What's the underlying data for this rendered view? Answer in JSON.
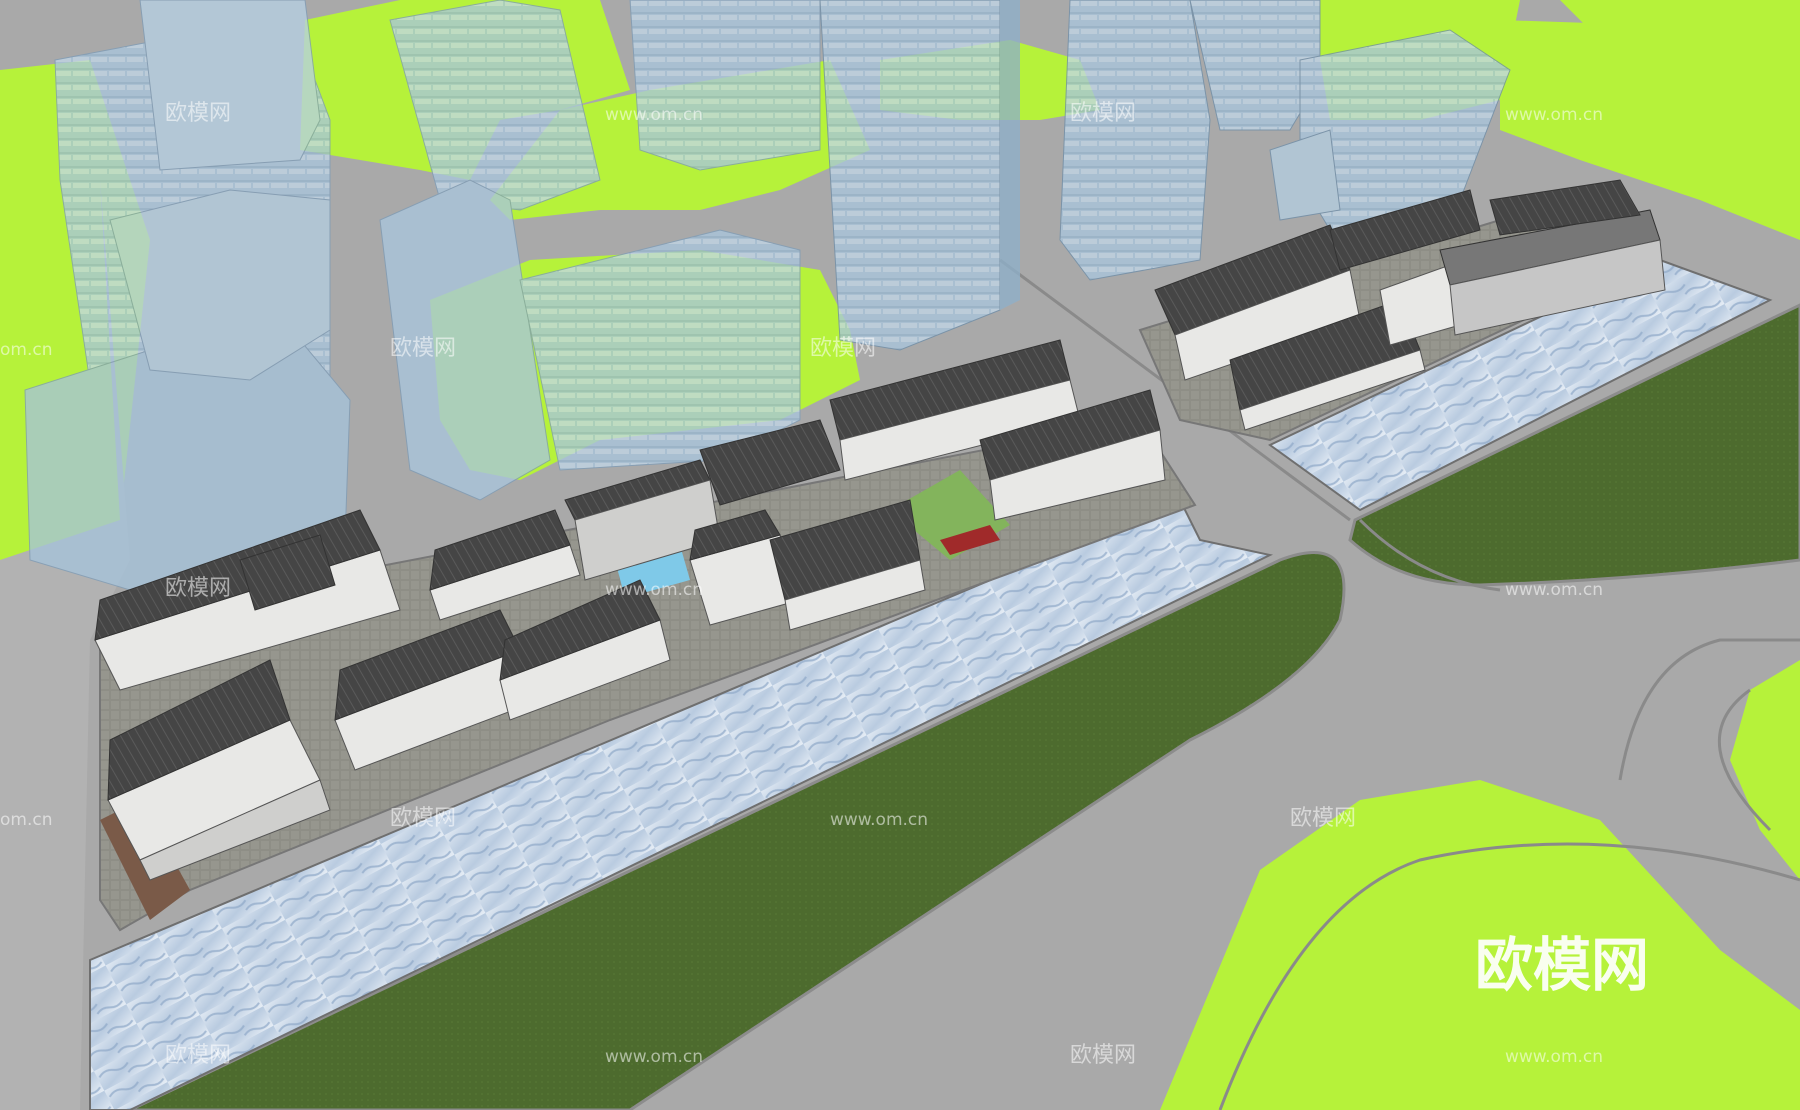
{
  "watermarks": {
    "brand_cn": "欧模网",
    "site": "www.om.cn",
    "site_short": "om.cn",
    "big_logo": "欧模网"
  },
  "colors": {
    "road": "#a9a9a9",
    "road_light": "#bdbdbd",
    "lawn": "#b6f23a",
    "dark_lawn": "#4c6a2e",
    "water": "#c4d3e6",
    "glass": "#a9c6dd",
    "roof": "#4a4a4a",
    "wall": "#e8e8e6",
    "paving": "#8f8f86",
    "deck": "#7a5a48"
  }
}
